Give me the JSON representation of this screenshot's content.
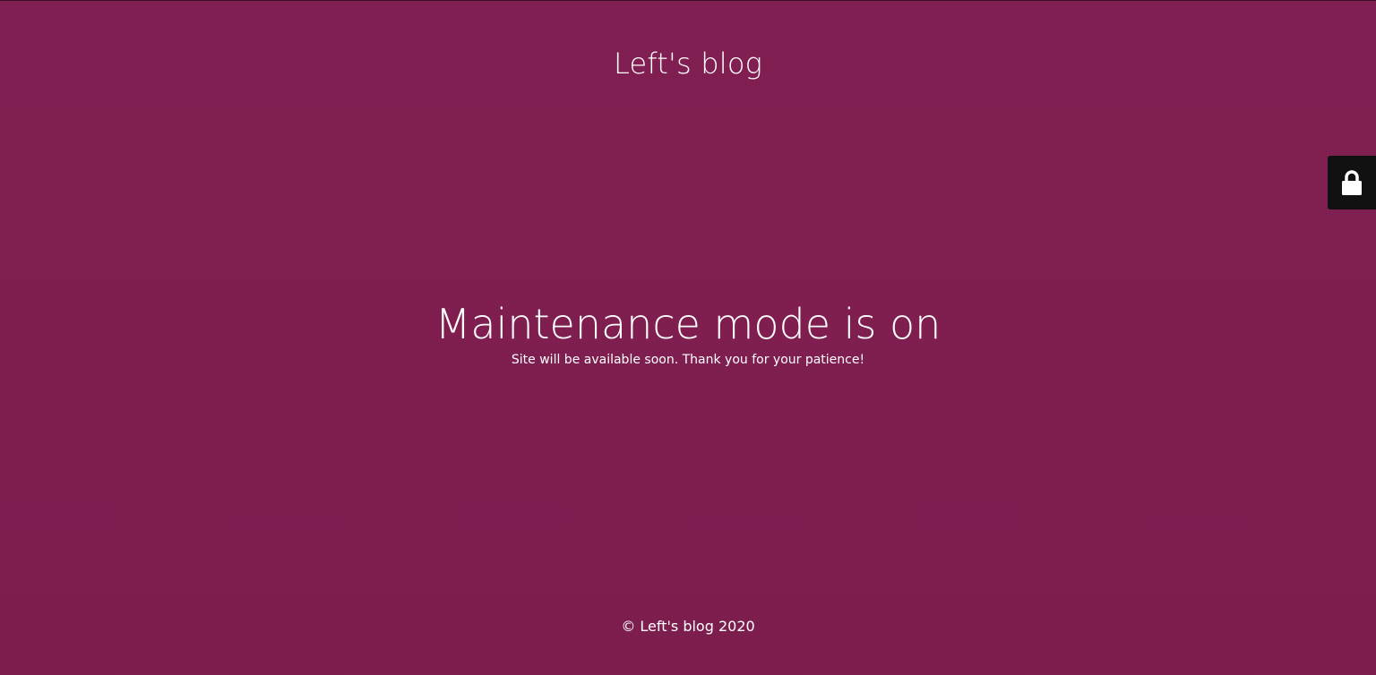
{
  "site": {
    "title": "Left's blog"
  },
  "maintenance": {
    "headline": "Maintenance mode is on",
    "message": "Site will be available soon. Thank you for your patience!"
  },
  "footer": {
    "copyright": "© Left's blog 2020"
  },
  "lock_tab": {
    "icon": "lock-icon"
  },
  "colors": {
    "background": "#821f52",
    "text": "#ffffff",
    "lock_tab_background": "#111111"
  }
}
